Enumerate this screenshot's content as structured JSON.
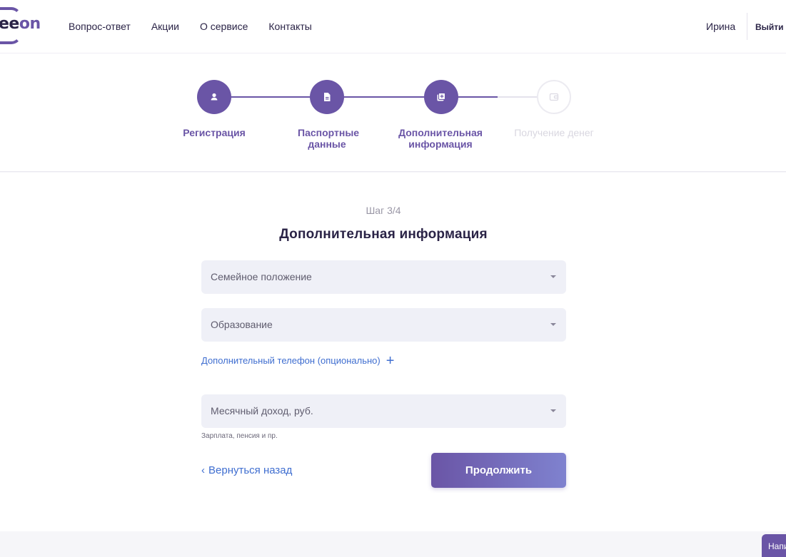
{
  "header": {
    "logo_text_main": "ee",
    "logo_text_accent": "on",
    "nav": [
      "Вопрос-ответ",
      "Акции",
      "О сервисе",
      "Контакты"
    ],
    "user_name": "Ирина",
    "logout_label": "Выйти"
  },
  "stepper": {
    "steps": [
      {
        "label": "Регистрация",
        "state": "done",
        "icon": "user-icon"
      },
      {
        "label": "Паспортные данные",
        "state": "done",
        "icon": "document-icon"
      },
      {
        "label": "Дополнительная информация",
        "state": "done",
        "icon": "add-document-icon"
      },
      {
        "label": "Получение денег",
        "state": "todo",
        "icon": "wallet-icon"
      }
    ]
  },
  "form": {
    "step_counter": "Шаг 3/4",
    "title": "Дополнительная информация",
    "fields": {
      "marital_status": "Семейное положение",
      "education": "Образование",
      "monthly_income": "Месячный доход, руб."
    },
    "add_phone_label": "Дополнительный телефон (опционально)",
    "income_hint": "Зарплата, пенсия и пр.",
    "back_label": "Вернуться назад",
    "continue_label": "Продолжить"
  },
  "chat_button_label": "Напишите нам",
  "colors": {
    "accent": "#6a55a6",
    "link": "#3f6ed0",
    "field_bg": "#eff0f7"
  }
}
